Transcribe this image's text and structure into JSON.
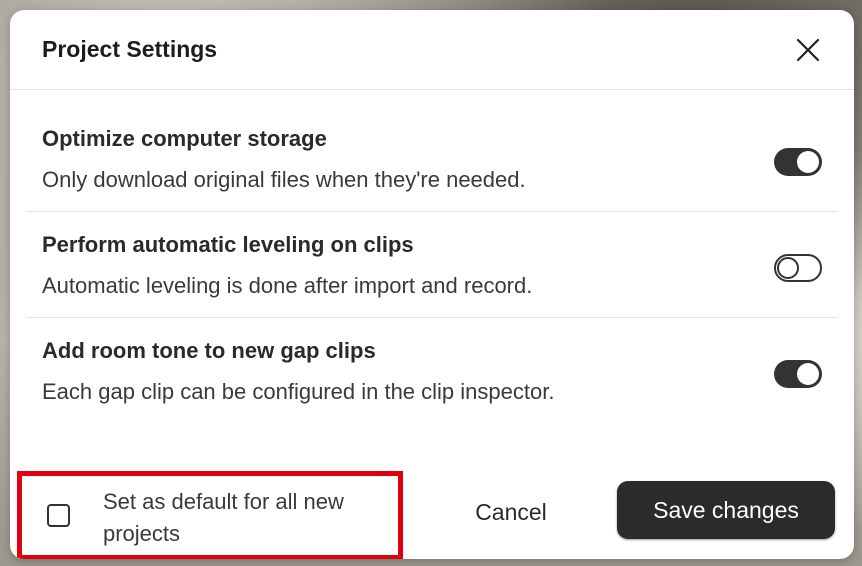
{
  "dialog": {
    "title": "Project Settings",
    "close_icon": "close-icon"
  },
  "settings": [
    {
      "title": "Optimize computer storage",
      "description": "Only download original files when they're needed.",
      "enabled": true
    },
    {
      "title": "Perform automatic leveling on clips",
      "description": "Automatic leveling is done after import and record.",
      "enabled": false
    },
    {
      "title": "Add room tone to new gap clips",
      "description": "Each gap clip can be configured in the clip inspector.",
      "enabled": true
    }
  ],
  "footer": {
    "default_checkbox_label": "Set as default for all new projects",
    "default_checked": false,
    "cancel_label": "Cancel",
    "save_label": "Save changes"
  },
  "colors": {
    "highlight_box": "#e0000e",
    "toggle_on": "#333333",
    "save_button": "#2b2b2b"
  }
}
